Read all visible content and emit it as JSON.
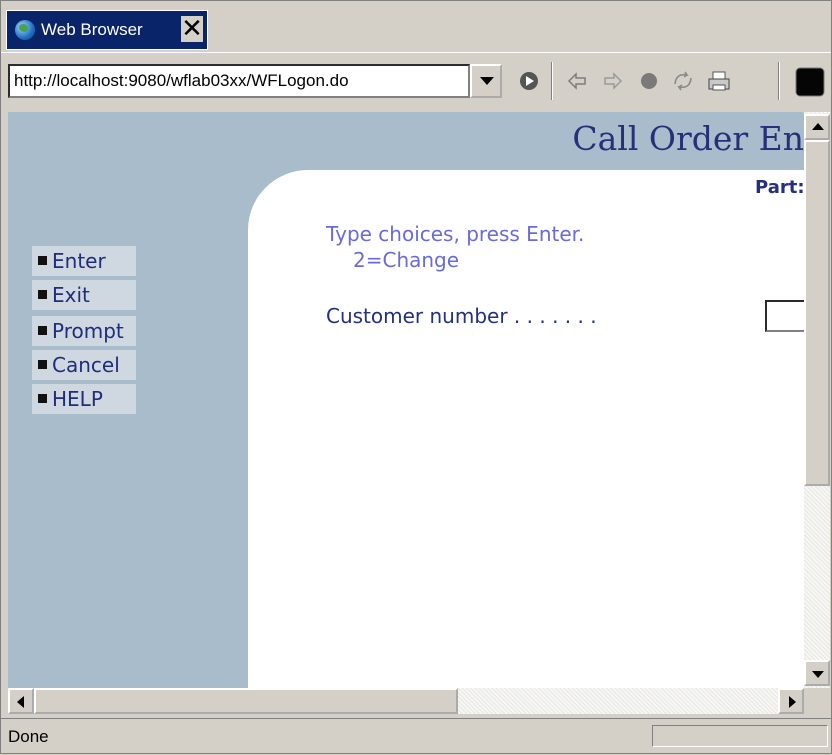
{
  "browser": {
    "tab_title": "Web Browser",
    "tab_close_glyph": "✕",
    "url": "http://localhost:9080/wflab03xx/WFLogon.do",
    "status": "Done",
    "icons": [
      "globe-icon",
      "go-icon",
      "back-icon",
      "forward-icon",
      "stop-icon",
      "refresh-icon",
      "print-icon",
      "black-square-icon"
    ]
  },
  "page": {
    "title": "Call Order En",
    "parts_label": "Part:",
    "instruction_line1": "Type choices, press Enter.",
    "instruction_line2": "2=Change",
    "customer_label": "Customer number . . . . . . .",
    "customer_value": "",
    "function_keys": [
      {
        "label": "Enter"
      },
      {
        "label": "Exit"
      },
      {
        "label": "Prompt"
      },
      {
        "label": "Cancel"
      },
      {
        "label": "HELP"
      }
    ]
  },
  "colors": {
    "page_background": "#a9bccb",
    "title_color": "#26307a",
    "instruction_color": "#6a6ad8",
    "tab_active": "#0a246a"
  }
}
